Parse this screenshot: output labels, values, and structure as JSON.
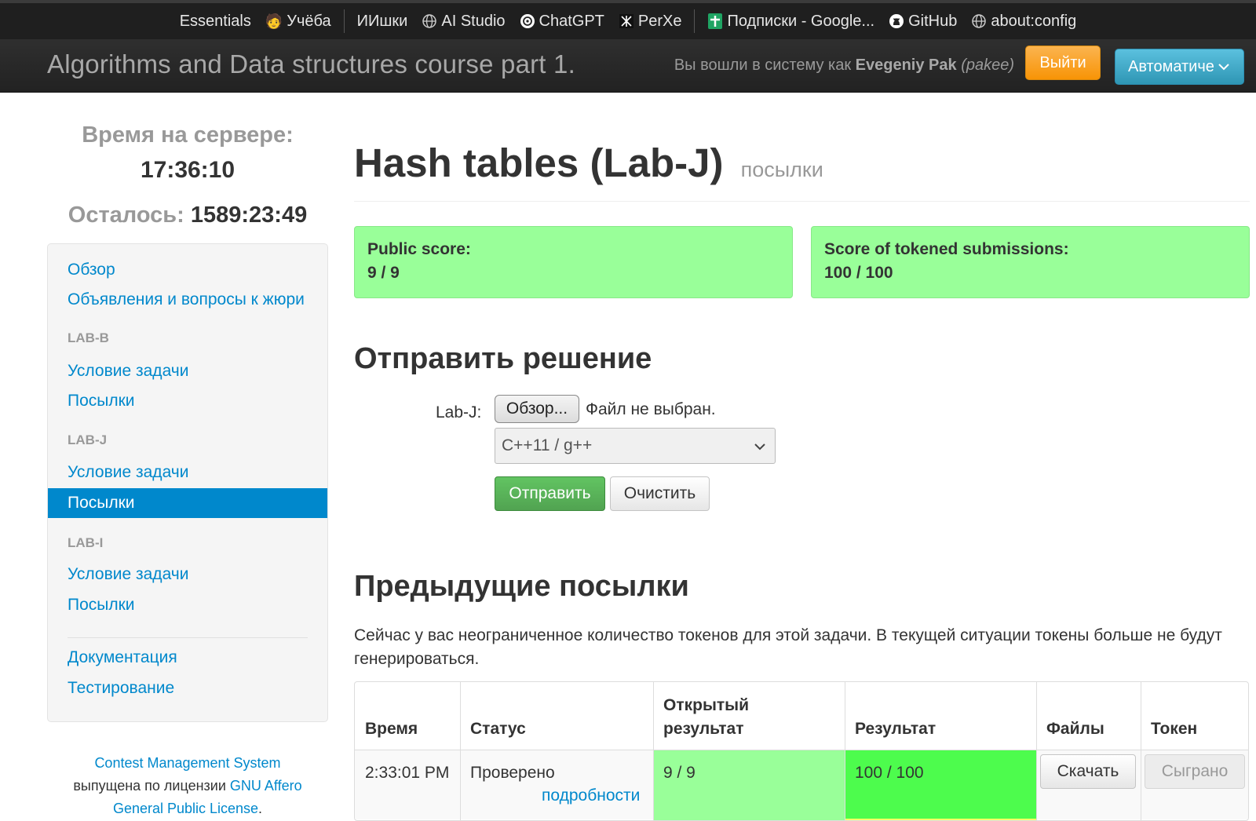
{
  "bookmarks": [
    {
      "label": "Essentials",
      "icon": "none"
    },
    {
      "label": "Учёба",
      "icon": "graduate-emoji-icon"
    },
    {
      "label": "ИИшки",
      "icon": "none"
    },
    {
      "label": "AI Studio",
      "icon": "globe-icon"
    },
    {
      "label": "ChatGPT",
      "icon": "chatgpt-icon"
    },
    {
      "label": "PerXe",
      "icon": "perxe-icon"
    },
    {
      "label": "Подписки - Google...",
      "icon": "sheets-icon"
    },
    {
      "label": "GitHub",
      "icon": "github-icon"
    },
    {
      "label": "about:config",
      "icon": "globe-icon"
    }
  ],
  "navbar": {
    "brand": "Algorithms and Data structures course part 1.",
    "login_prefix": "Вы вошли в систему как",
    "user_name": "Evegeniy Pak",
    "user_login": "(pakee)",
    "logout_label": "Выйти",
    "language_label": "Автоматиче"
  },
  "sidebar": {
    "server_time_label": "Время на сервере:",
    "server_time": "17:36:10",
    "remaining_label": "Осталось:",
    "remaining_value": "1589:23:49",
    "overview": "Обзор",
    "announcements": "Объявления и вопросы к жюри",
    "sections": [
      {
        "header": "LAB-B",
        "statement": "Условие задачи",
        "submissions": "Посылки"
      },
      {
        "header": "LAB-J",
        "statement": "Условие задачи",
        "submissions": "Посылки"
      },
      {
        "header": "LAB-I",
        "statement": "Условие задачи",
        "submissions": "Посылки"
      }
    ],
    "documentation": "Документация",
    "testing": "Тестирование"
  },
  "footer": {
    "cms_link": "Contest Management System",
    "released_text": "выпущена по лицензии",
    "license_link_1": "GNU Affero",
    "license_link_2": "General Public License",
    "period": "."
  },
  "main": {
    "title": "Hash tables (Lab-J)",
    "title_sub": "посылки",
    "public_score_label": "Public score:",
    "public_score_value": "9 / 9",
    "token_score_label": "Score of tokened submissions:",
    "token_score_value": "100 / 100",
    "submit_heading": "Отправить решение",
    "file_label": "Lab-J:",
    "browse_label": "Обзор...",
    "file_status": "Файл не выбран.",
    "language_selected": "C++11 / g++",
    "submit_label": "Отправить",
    "clear_label": "Очистить",
    "previous_heading": "Предыдущие посылки",
    "tokens_info": "Сейчас у вас неограниченное количество токенов для этой задачи. В текущей ситуации токены больше не будут генерироваться."
  },
  "table": {
    "headers": {
      "time": "Время",
      "status": "Статус",
      "public_line1": "Открытый",
      "public_line2": "результат",
      "result": "Результат",
      "files": "Файлы",
      "token": "Токен"
    },
    "rows": [
      {
        "time": "2:33:01 PM",
        "status": "Проверено",
        "details": "подробности",
        "public_result": "9 / 9",
        "result": "100 / 100",
        "download": "Скачать",
        "token": "Сыграно"
      }
    ]
  },
  "colors": {
    "link": "#0088cc",
    "score_bg": "#99ff99",
    "result_bg": "#4dfc4d",
    "logout": "#f89406",
    "language_btn": "#2f96b4",
    "submit_btn": "#51a351"
  }
}
